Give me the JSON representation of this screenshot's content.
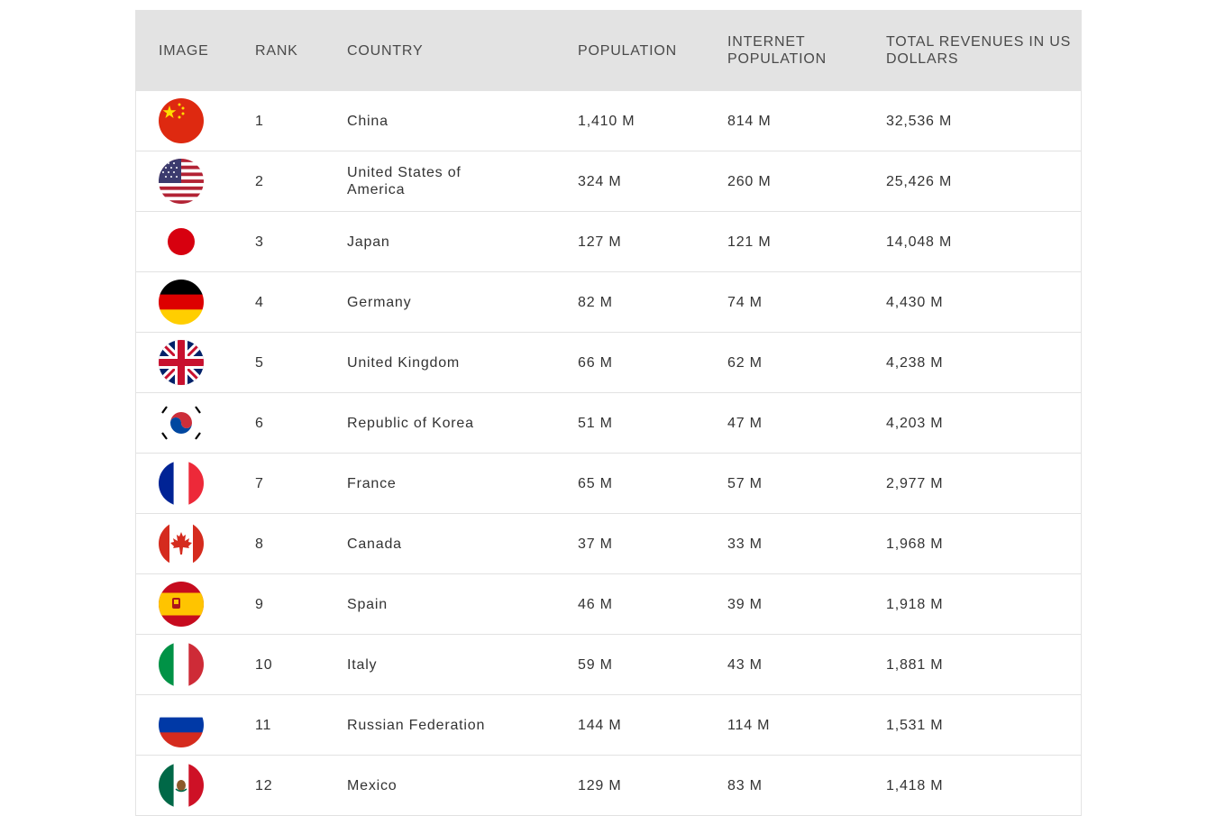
{
  "table": {
    "headers": {
      "image": "IMAGE",
      "rank": "RANK",
      "country": "COUNTRY",
      "population": "POPULATION",
      "internet_population": "INTERNET POPULATION",
      "revenues": "TOTAL REVENUES IN US DOLLARS"
    },
    "rows": [
      {
        "flag": "china-flag-icon",
        "rank": "1",
        "country": "China",
        "population": "1,410 M",
        "internet": "814 M",
        "revenue": "32,536 M"
      },
      {
        "flag": "usa-flag-icon",
        "rank": "2",
        "country": "United States of America",
        "population": "324 M",
        "internet": "260 M",
        "revenue": "25,426 M"
      },
      {
        "flag": "japan-flag-icon",
        "rank": "3",
        "country": "Japan",
        "population": "127 M",
        "internet": "121 M",
        "revenue": "14,048 M"
      },
      {
        "flag": "germany-flag-icon",
        "rank": "4",
        "country": "Germany",
        "population": "82 M",
        "internet": "74 M",
        "revenue": "4,430 M"
      },
      {
        "flag": "uk-flag-icon",
        "rank": "5",
        "country": "United Kingdom",
        "population": "66 M",
        "internet": "62 M",
        "revenue": "4,238 M"
      },
      {
        "flag": "korea-flag-icon",
        "rank": "6",
        "country": "Republic of Korea",
        "population": "51 M",
        "internet": "47 M",
        "revenue": "4,203 M"
      },
      {
        "flag": "france-flag-icon",
        "rank": "7",
        "country": "France",
        "population": "65 M",
        "internet": "57 M",
        "revenue": "2,977 M"
      },
      {
        "flag": "canada-flag-icon",
        "rank": "8",
        "country": "Canada",
        "population": "37 M",
        "internet": "33 M",
        "revenue": "1,968 M"
      },
      {
        "flag": "spain-flag-icon",
        "rank": "9",
        "country": "Spain",
        "population": "46 M",
        "internet": "39 M",
        "revenue": "1,918 M"
      },
      {
        "flag": "italy-flag-icon",
        "rank": "10",
        "country": "Italy",
        "population": "59 M",
        "internet": "43 M",
        "revenue": "1,881 M"
      },
      {
        "flag": "russia-flag-icon",
        "rank": "11",
        "country": "Russian Federation",
        "population": "144 M",
        "internet": "114 M",
        "revenue": "1,531 M"
      },
      {
        "flag": "mexico-flag-icon",
        "rank": "12",
        "country": "Mexico",
        "population": "129 M",
        "internet": "83 M",
        "revenue": "1,418 M"
      }
    ]
  },
  "colors": {
    "header_bg": "#e3e3e3",
    "row_border": "#e2e2e2",
    "text": "#333333"
  }
}
